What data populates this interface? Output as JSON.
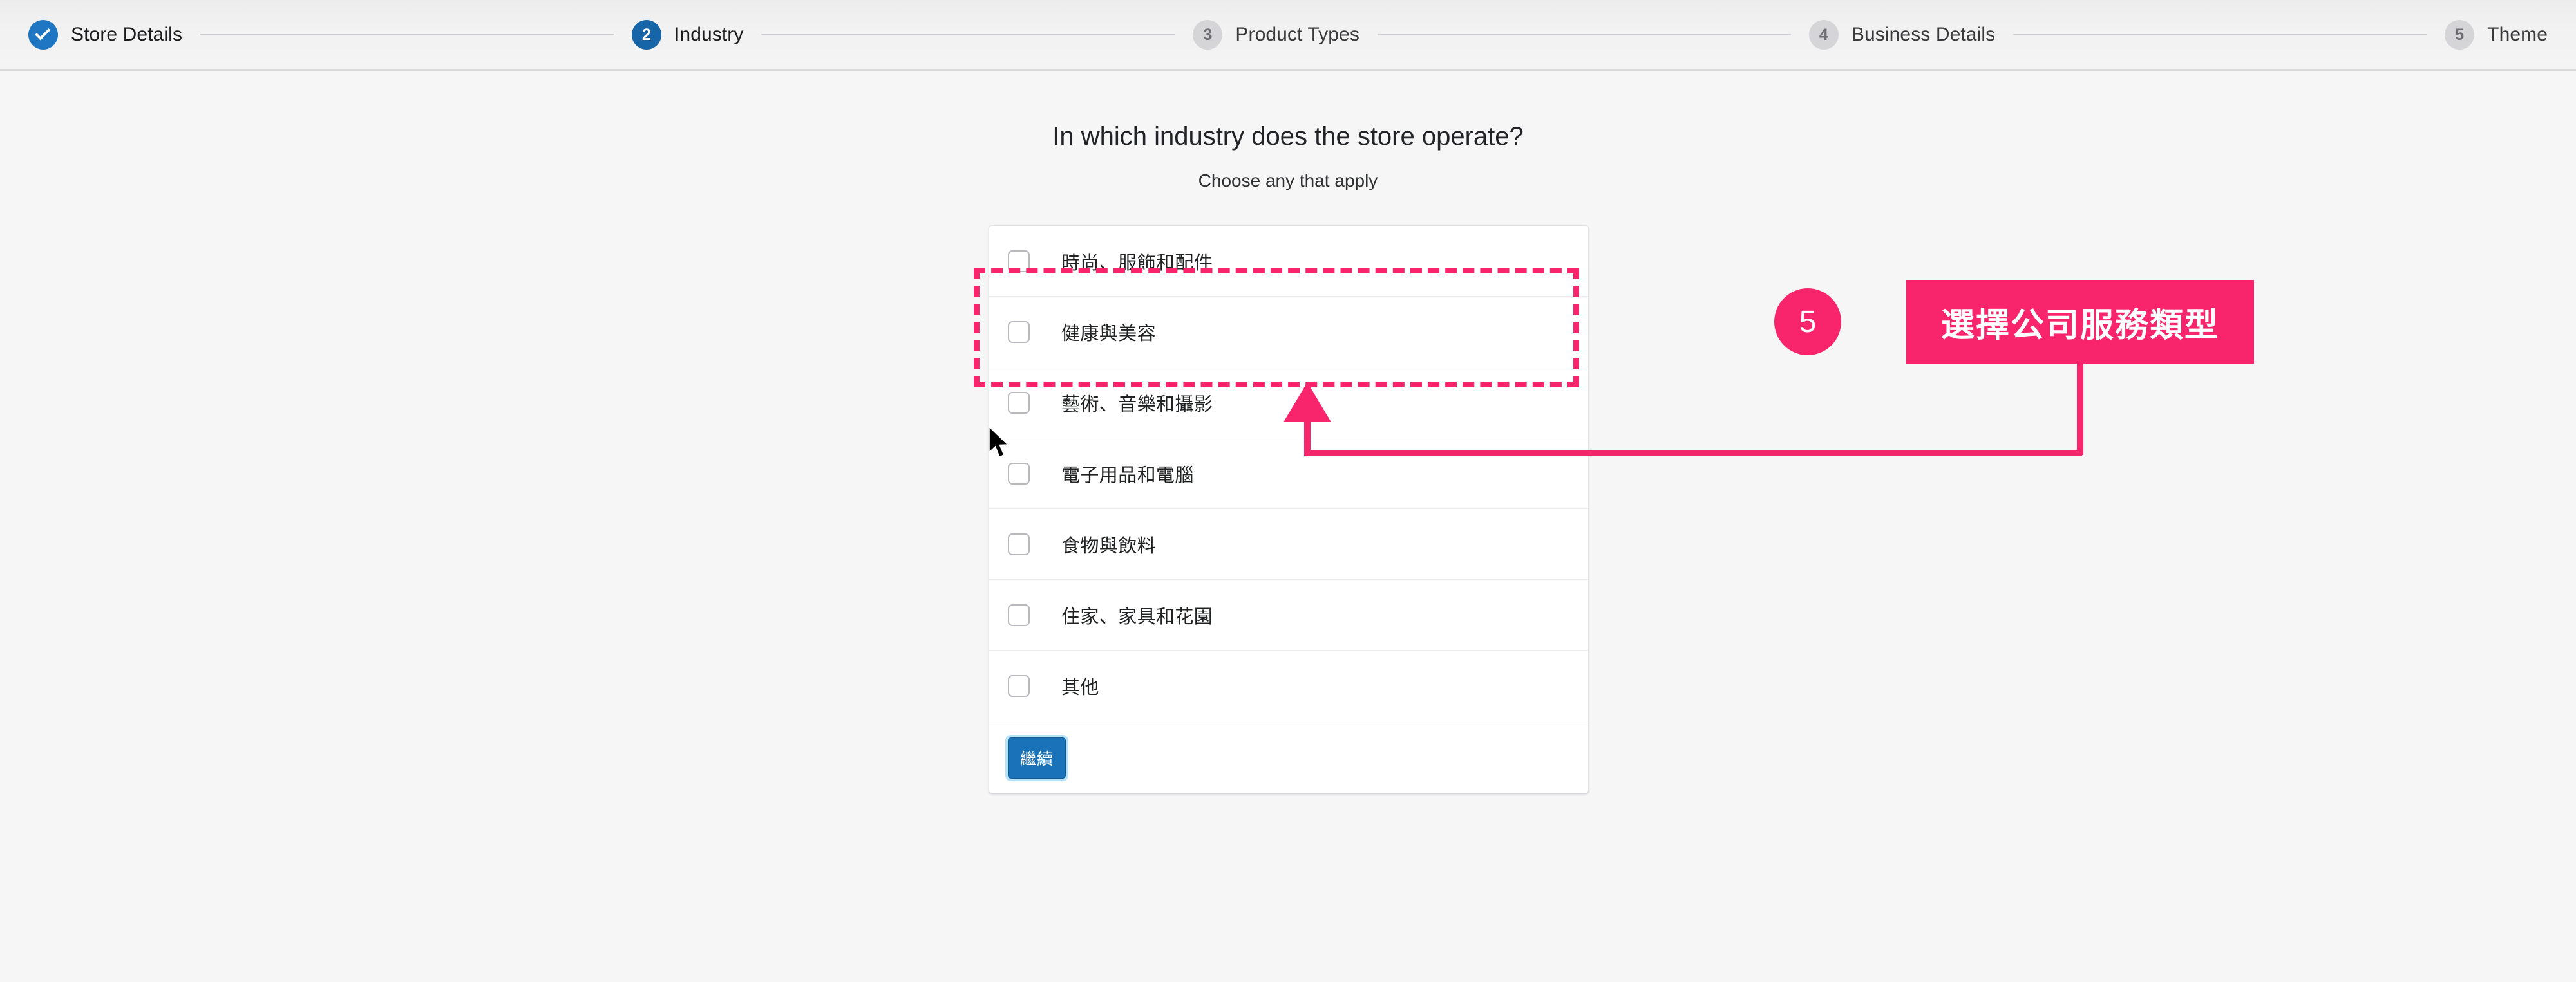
{
  "stepper": {
    "steps": [
      {
        "num": "1",
        "label": "Store Details",
        "state": "done",
        "icon": "check-icon"
      },
      {
        "num": "2",
        "label": "Industry",
        "state": "current",
        "icon": ""
      },
      {
        "num": "3",
        "label": "Product Types",
        "state": "pending",
        "icon": ""
      },
      {
        "num": "4",
        "label": "Business Details",
        "state": "pending",
        "icon": ""
      },
      {
        "num": "5",
        "label": "Theme",
        "state": "pending",
        "icon": ""
      }
    ]
  },
  "main": {
    "headline": "In which industry does the store operate?",
    "subhead": "Choose any that apply",
    "options": [
      {
        "label": "時尚、服飾和配件",
        "checked": false
      },
      {
        "label": "健康與美容",
        "checked": false
      },
      {
        "label": "藝術、音樂和攝影",
        "checked": false
      },
      {
        "label": "電子用品和電腦",
        "checked": false
      },
      {
        "label": "食物與飲料",
        "checked": false
      },
      {
        "label": "住家、家具和花園",
        "checked": false
      },
      {
        "label": "其他",
        "checked": false
      }
    ],
    "continue_label": "繼續"
  },
  "annotation": {
    "badge_number": "5",
    "label_text": "選擇公司服務類型",
    "color": "#f8246c",
    "target_option_index": 0
  },
  "colors": {
    "accent_pink": "#f8246c",
    "primary_blue": "#1a72b8",
    "step_done_blue": "#1f77c4",
    "page_background": "#f6f6f7",
    "card_background": "#ffffff"
  }
}
